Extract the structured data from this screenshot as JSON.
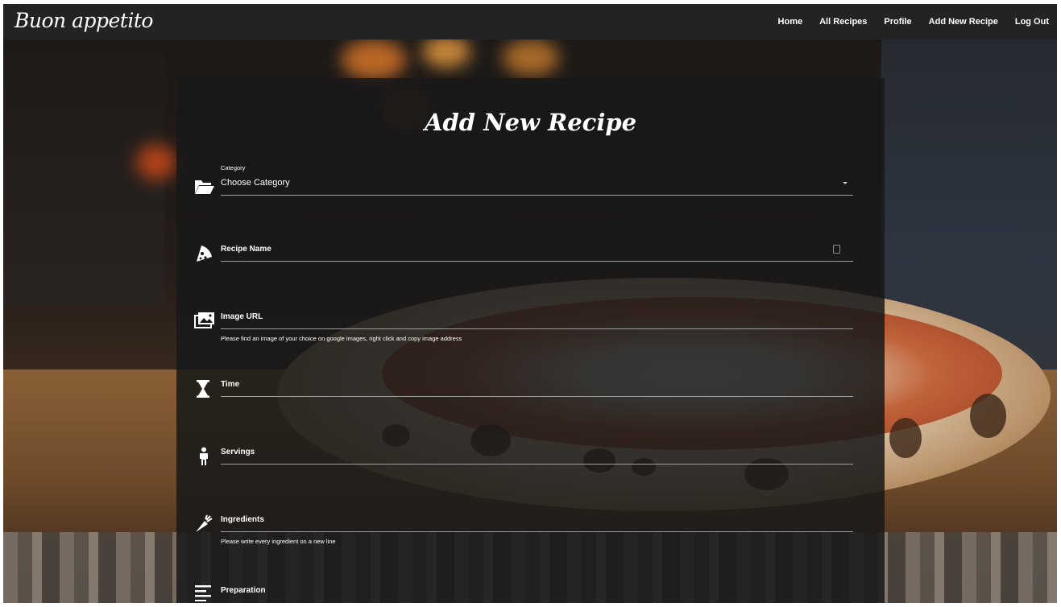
{
  "brand": "Buon appetito",
  "nav": {
    "items": [
      "Home",
      "All Recipes",
      "Profile",
      "Add New Recipe",
      "Log Out"
    ]
  },
  "form": {
    "title": "Add New Recipe",
    "category": {
      "label": "Category",
      "selected": "Choose Category",
      "icon": "folder-open-icon"
    },
    "recipe_name": {
      "label": "Recipe Name",
      "icon": "pizza-slice-icon"
    },
    "image_url": {
      "label": "Image URL",
      "helper": "Please find an image of your choice on google images, right click and copy image address",
      "icon": "images-icon"
    },
    "time": {
      "label": "Time",
      "icon": "hourglass-icon"
    },
    "servings": {
      "label": "Servings",
      "icon": "person-icon"
    },
    "ingredients": {
      "label": "Ingredients",
      "helper": "Please write every ingredient on a new line",
      "icon": "carrot-icon"
    },
    "preparation": {
      "label": "Preparation",
      "icon": "align-left-icon"
    }
  }
}
